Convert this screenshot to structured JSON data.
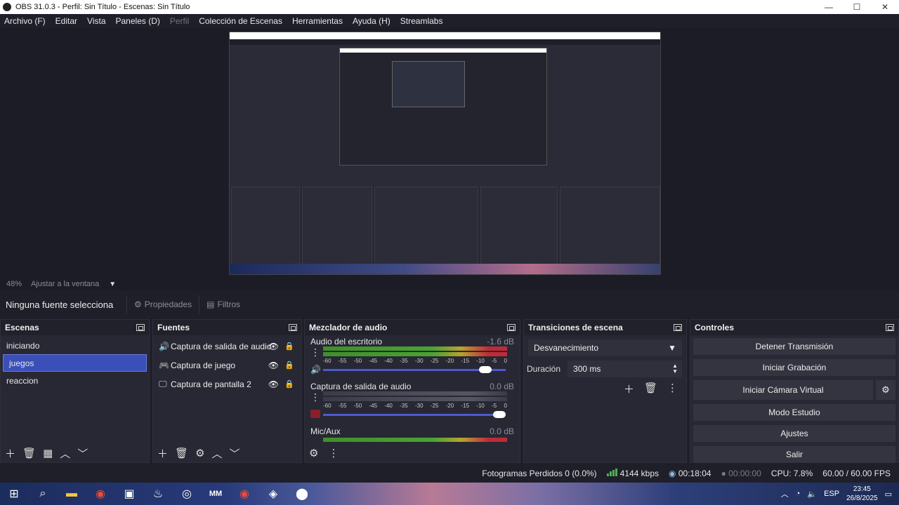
{
  "window": {
    "title": "OBS 31.0.3 - Perfil: Sin Título - Escenas: Sin Título",
    "min": "—",
    "max": "☐",
    "close": "✕"
  },
  "menu": [
    "Archivo (F)",
    "Editar",
    "Vista",
    "Paneles (D)",
    "Perfil",
    "Colección de Escenas",
    "Herramientas",
    "Ayuda (H)",
    "Streamlabs"
  ],
  "zoom": {
    "percent": "48%",
    "fit": "Ajustar a la ventana"
  },
  "source_toolbar": {
    "status": "Ninguna fuente selecciona",
    "properties": "Propiedades",
    "filters": "Filtros"
  },
  "scenes": {
    "title": "Escenas",
    "items": [
      "iniciando",
      "juegos",
      "reaccion"
    ],
    "selected": 1
  },
  "sources": {
    "title": "Fuentes",
    "items": [
      {
        "icon": "speaker-icon",
        "label": "Captura de salida de audio"
      },
      {
        "icon": "gamepad-icon",
        "label": "Captura de juego"
      },
      {
        "icon": "monitor-icon",
        "label": "Captura de pantalla 2"
      }
    ]
  },
  "mixer": {
    "title": "Mezclador de audio",
    "channels": [
      {
        "name": "Audio del escritorio",
        "db": "-1.6 dB",
        "level": 0.88,
        "volume": 0.93,
        "muted": false
      },
      {
        "name": "Captura de salida de audio",
        "db": "0.0 dB",
        "level": 0.0,
        "volume": 1.0,
        "muted": true
      },
      {
        "name": "Mic/Aux",
        "db": "0.0 dB",
        "level": 0.9,
        "volume": 1.0,
        "muted": false
      }
    ],
    "ticks": [
      "-60",
      "-55",
      "-50",
      "-45",
      "-40",
      "-35",
      "-30",
      "-25",
      "-20",
      "-15",
      "-10",
      "-5",
      "0"
    ]
  },
  "transitions": {
    "title": "Transiciones de escena",
    "selected": "Desvanecimiento",
    "duration_label": "Duración",
    "duration_value": "300 ms"
  },
  "controls": {
    "title": "Controles",
    "buttons": [
      "Detener Transmisión",
      "Iniciar Grabación",
      "Iniciar Cámara Virtual",
      "Modo Estudio",
      "Ajustes",
      "Salir"
    ]
  },
  "status": {
    "frames": "Fotogramas Perdidos 0 (0.0%)",
    "bitrate": "4144 kbps",
    "stream_time": "00:18:04",
    "rec_time": "00:00:00",
    "cpu": "CPU: 7.8%",
    "fps": "60.00 / 60.00 FPS"
  },
  "taskbar": {
    "lang": "ESP",
    "time": "23:45",
    "date": "26/8/2025"
  },
  "colors": {
    "accent": "#3b4fb8",
    "bg": "#1e1f29",
    "dock": "#272833"
  }
}
